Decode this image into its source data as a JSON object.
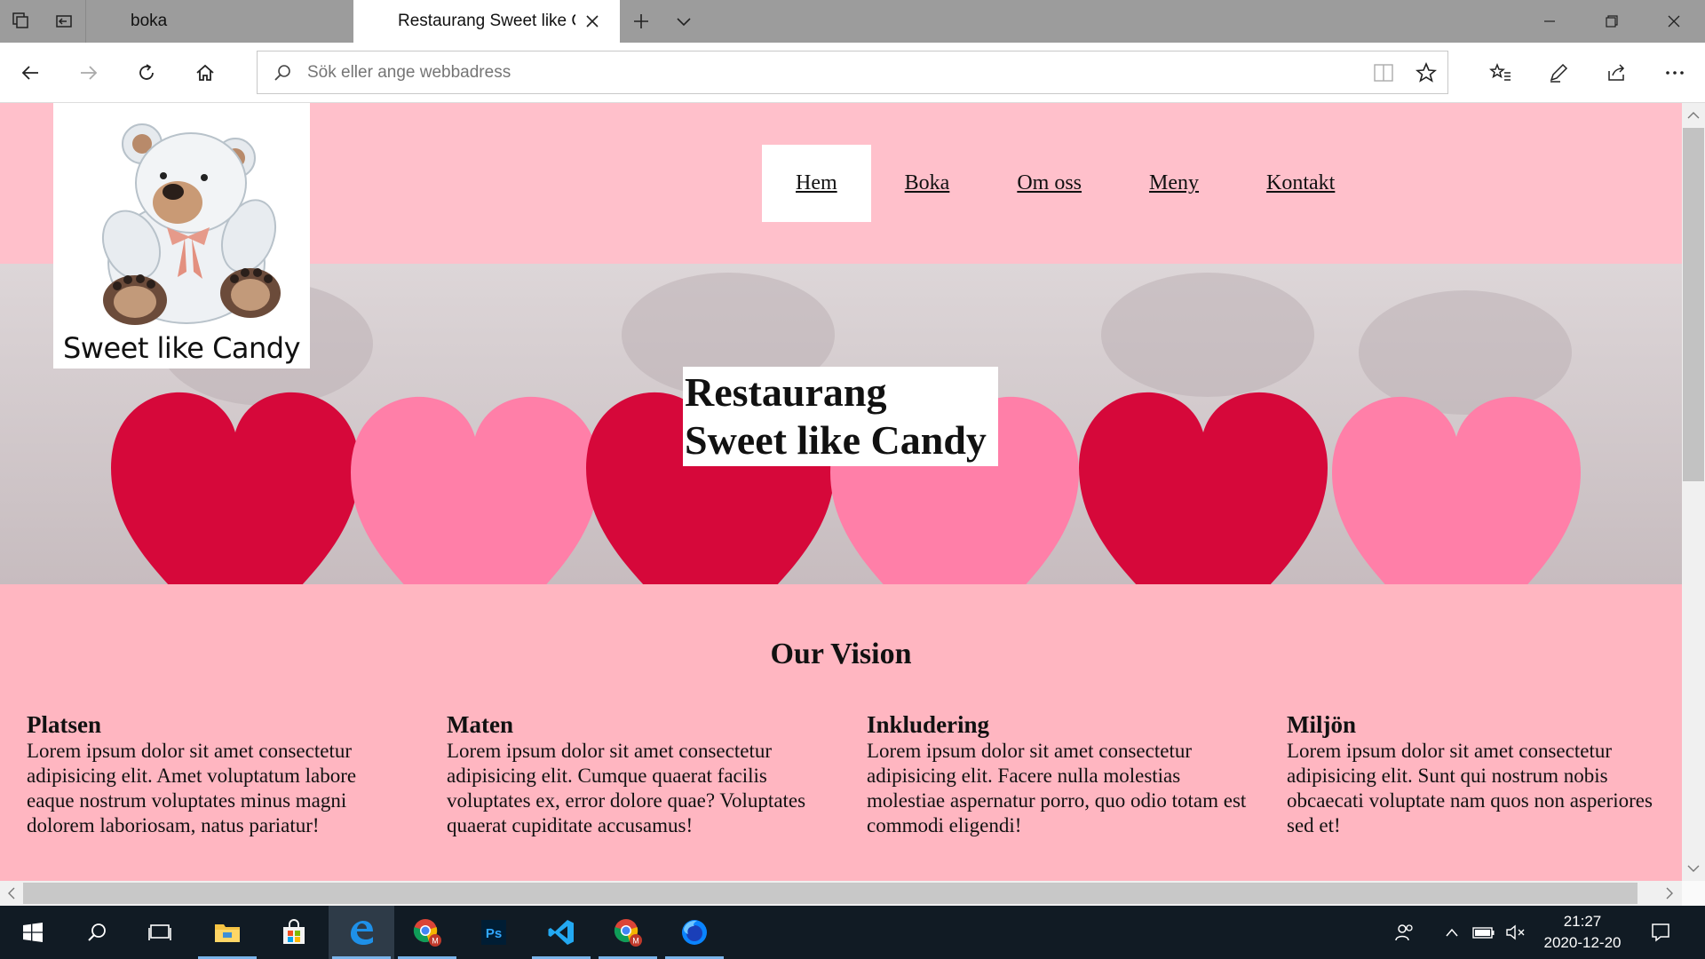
{
  "browser": {
    "tabs": [
      {
        "title": "boka",
        "active": false
      },
      {
        "title": "Restaurang Sweet like Candy",
        "active": true
      }
    ],
    "address_placeholder": "Sök eller ange webbadress"
  },
  "site": {
    "logo_text": "Sweet like Candy",
    "menu": [
      "Hem",
      "Boka",
      "Om oss",
      "Meny",
      "Kontakt"
    ],
    "current_menu": "Hem",
    "hero": {
      "line1": "Restaurang",
      "line2": "Sweet like Candy"
    },
    "vision": {
      "title": "Our Vision",
      "columns": [
        {
          "heading": "Platsen",
          "text": "Lorem ipsum dolor sit amet consectetur adipisicing elit. Amet voluptatum labore eaque nostrum voluptates minus magni dolorem laboriosam, natus pariatur!"
        },
        {
          "heading": "Maten",
          "text": "Lorem ipsum dolor sit amet consectetur adipisicing elit. Cumque quaerat facilis voluptates ex, error dolore quae? Voluptates quaerat cupiditate accusamus!"
        },
        {
          "heading": "Inkludering",
          "text": "Lorem ipsum dolor sit amet consectetur adipisicing elit. Facere nulla molestias molestiae aspernatur porro, quo odio totam est commodi eligendi!"
        },
        {
          "heading": "Miljön",
          "text": "Lorem ipsum dolor sit amet consectetur adipisicing elit. Sunt qui nostrum nobis obcaecati voluptate nam quos non asperiores sed et!"
        }
      ]
    },
    "colors": {
      "header_bg": "#ffc0cb",
      "body_bg": "#ffb6c1",
      "heart_red": "#d6083a",
      "heart_pink": "#ff7fa8"
    }
  },
  "taskbar": {
    "apps": [
      "start",
      "search",
      "task-view",
      "file-explorer",
      "store",
      "edge",
      "chrome",
      "photoshop",
      "vscode",
      "chrome",
      "firefox"
    ],
    "time": "21:27",
    "date": "2020-12-20"
  }
}
